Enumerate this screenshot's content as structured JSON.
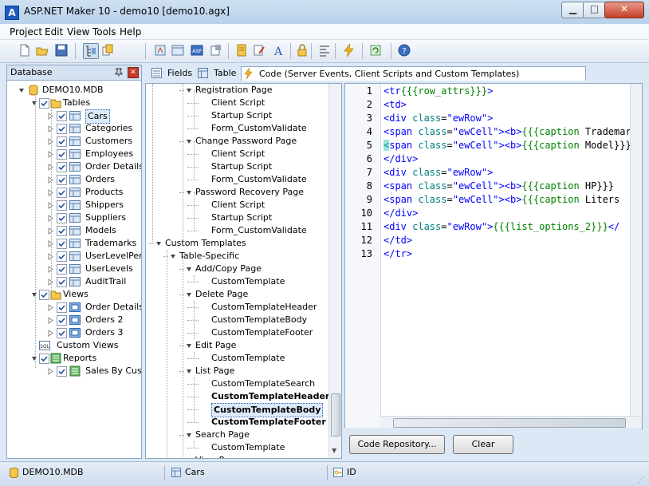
{
  "window": {
    "title": "ASP.NET Maker 10 - demo10 [demo10.agx]",
    "app_icon": "A"
  },
  "menu": [
    "Project",
    "Edit",
    "View",
    "Tools",
    "Help"
  ],
  "toolbar_icons": [
    "new-icon",
    "open-icon",
    "save-icon",
    "tree-view-icon",
    "copy-icon",
    "build-icon",
    "project-icon",
    "asp-icon",
    "settings-icon",
    "generate-icon",
    "edit-icon",
    "font-icon",
    "lock-icon",
    "align-icon",
    "lightning-icon",
    "refresh-icon",
    "help-icon"
  ],
  "db_panel": {
    "title": "Database",
    "root": "DEMO10.MDB",
    "tables_group": "Tables",
    "tables": [
      "Cars",
      "Categories",
      "Customers",
      "Employees",
      "Order Details",
      "Orders",
      "Products",
      "Shippers",
      "Suppliers",
      "Models",
      "Trademarks",
      "UserLevelPerm",
      "UserLevels",
      "AuditTrail"
    ],
    "selected_table": "Cars",
    "views_group": "Views",
    "views": [
      "Order Details E",
      "Orders 2",
      "Orders 3"
    ],
    "custom_views": "Custom Views",
    "reports_group": "Reports",
    "reports": [
      "Sales By Custo"
    ]
  },
  "tabs": [
    "Fields",
    "Table",
    "Code (Server Events, Client Scripts and Custom Templates)"
  ],
  "mid_tree": [
    {
      "label": "Registration Page",
      "level": 2,
      "type": "node"
    },
    {
      "label": "Client Script",
      "level": 3,
      "type": "leaf"
    },
    {
      "label": "Startup Script",
      "level": 3,
      "type": "leaf"
    },
    {
      "label": "Form_CustomValidate",
      "level": 3,
      "type": "leaf"
    },
    {
      "label": "Change Password Page",
      "level": 2,
      "type": "node"
    },
    {
      "label": "Client Script",
      "level": 3,
      "type": "leaf"
    },
    {
      "label": "Startup Script",
      "level": 3,
      "type": "leaf"
    },
    {
      "label": "Form_CustomValidate",
      "level": 3,
      "type": "leaf"
    },
    {
      "label": "Password Recovery Page",
      "level": 2,
      "type": "node"
    },
    {
      "label": "Client Script",
      "level": 3,
      "type": "leaf"
    },
    {
      "label": "Startup Script",
      "level": 3,
      "type": "leaf"
    },
    {
      "label": "Form_CustomValidate",
      "level": 3,
      "type": "leaf"
    },
    {
      "label": "Custom Templates",
      "level": 0,
      "type": "node"
    },
    {
      "label": "Table-Specific",
      "level": 1,
      "type": "node"
    },
    {
      "label": "Add/Copy Page",
      "level": 2,
      "type": "node"
    },
    {
      "label": "CustomTemplate",
      "level": 3,
      "type": "leaf"
    },
    {
      "label": "Delete Page",
      "level": 2,
      "type": "node"
    },
    {
      "label": "CustomTemplateHeader",
      "level": 3,
      "type": "leaf"
    },
    {
      "label": "CustomTemplateBody",
      "level": 3,
      "type": "leaf"
    },
    {
      "label": "CustomTemplateFooter",
      "level": 3,
      "type": "leaf"
    },
    {
      "label": "Edit Page",
      "level": 2,
      "type": "node"
    },
    {
      "label": "CustomTemplate",
      "level": 3,
      "type": "leaf"
    },
    {
      "label": "List Page",
      "level": 2,
      "type": "node"
    },
    {
      "label": "CustomTemplateSearch",
      "level": 3,
      "type": "leaf"
    },
    {
      "label": "CustomTemplateHeader",
      "level": 3,
      "type": "leaf",
      "bold": true
    },
    {
      "label": "CustomTemplateBody",
      "level": 3,
      "type": "leaf",
      "bold": true,
      "selected": true
    },
    {
      "label": "CustomTemplateFooter",
      "level": 3,
      "type": "leaf",
      "bold": true
    },
    {
      "label": "Search Page",
      "level": 2,
      "type": "node"
    },
    {
      "label": "CustomTemplate",
      "level": 3,
      "type": "leaf"
    },
    {
      "label": "View Page",
      "level": 2,
      "type": "node"
    }
  ],
  "code_lines": [
    {
      "n": "1",
      "parts": [
        [
          "tag",
          "<tr"
        ],
        [
          "tpl",
          "{{{row_attrs}}}"
        ],
        [
          "tag",
          ">"
        ]
      ]
    },
    {
      "n": "2",
      "parts": [
        [
          "tag",
          "<td>"
        ]
      ]
    },
    {
      "n": "3",
      "parts": [
        [
          "tag",
          "<div "
        ],
        [
          "attr",
          "class"
        ],
        [
          "txt",
          "="
        ],
        [
          "str",
          "\"ewRow\""
        ],
        [
          "tag",
          ">"
        ]
      ]
    },
    {
      "n": "4",
      "parts": [
        [
          "tag",
          "<span "
        ],
        [
          "attr",
          "class"
        ],
        [
          "txt",
          "="
        ],
        [
          "str",
          "\"ewCell\""
        ],
        [
          "tag",
          "><b>"
        ],
        [
          "tpl",
          "{{{caption "
        ],
        [
          "txt",
          "Trademark"
        ]
      ]
    },
    {
      "n": "5",
      "parts": [
        [
          "caret",
          "<"
        ],
        [
          "tag",
          "span "
        ],
        [
          "attr",
          "class"
        ],
        [
          "txt",
          "="
        ],
        [
          "str",
          "\"ewCell\""
        ],
        [
          "tag",
          "><b>"
        ],
        [
          "tpl",
          "{{{caption "
        ],
        [
          "txt",
          "Model}}}"
        ]
      ]
    },
    {
      "n": "6",
      "parts": [
        [
          "tag",
          "</div>"
        ]
      ]
    },
    {
      "n": "7",
      "parts": [
        [
          "tag",
          "<div "
        ],
        [
          "attr",
          "class"
        ],
        [
          "txt",
          "="
        ],
        [
          "str",
          "\"ewRow\""
        ],
        [
          "tag",
          ">"
        ]
      ]
    },
    {
      "n": "8",
      "parts": [
        [
          "tag",
          "<span "
        ],
        [
          "attr",
          "class"
        ],
        [
          "txt",
          "="
        ],
        [
          "str",
          "\"ewCell\""
        ],
        [
          "tag",
          "><b>"
        ],
        [
          "tpl",
          "{{{caption "
        ],
        [
          "txt",
          "HP}}}"
        ]
      ]
    },
    {
      "n": "9",
      "parts": [
        [
          "tag",
          "<span "
        ],
        [
          "attr",
          "class"
        ],
        [
          "txt",
          "="
        ],
        [
          "str",
          "\"ewCell\""
        ],
        [
          "tag",
          "><b>"
        ],
        [
          "tpl",
          "{{{caption "
        ],
        [
          "txt",
          "Liters"
        ]
      ]
    },
    {
      "n": "10",
      "parts": [
        [
          "tag",
          "</div>"
        ]
      ]
    },
    {
      "n": "11",
      "parts": [
        [
          "tag",
          "<div "
        ],
        [
          "attr",
          "class"
        ],
        [
          "txt",
          "="
        ],
        [
          "str",
          "\"ewRow\""
        ],
        [
          "tag",
          ">"
        ],
        [
          "tpl",
          "{{{list_options_2}}}"
        ],
        [
          "tag",
          "</"
        ]
      ]
    },
    {
      "n": "12",
      "parts": [
        [
          "tag",
          "</td>"
        ]
      ]
    },
    {
      "n": "13",
      "parts": [
        [
          "tag",
          "</tr>"
        ]
      ]
    }
  ],
  "buttons": {
    "code_repository": "Code Repository...",
    "clear": "Clear"
  },
  "status": {
    "db": "DEMO10.MDB",
    "table": "Cars",
    "field": "ID"
  }
}
